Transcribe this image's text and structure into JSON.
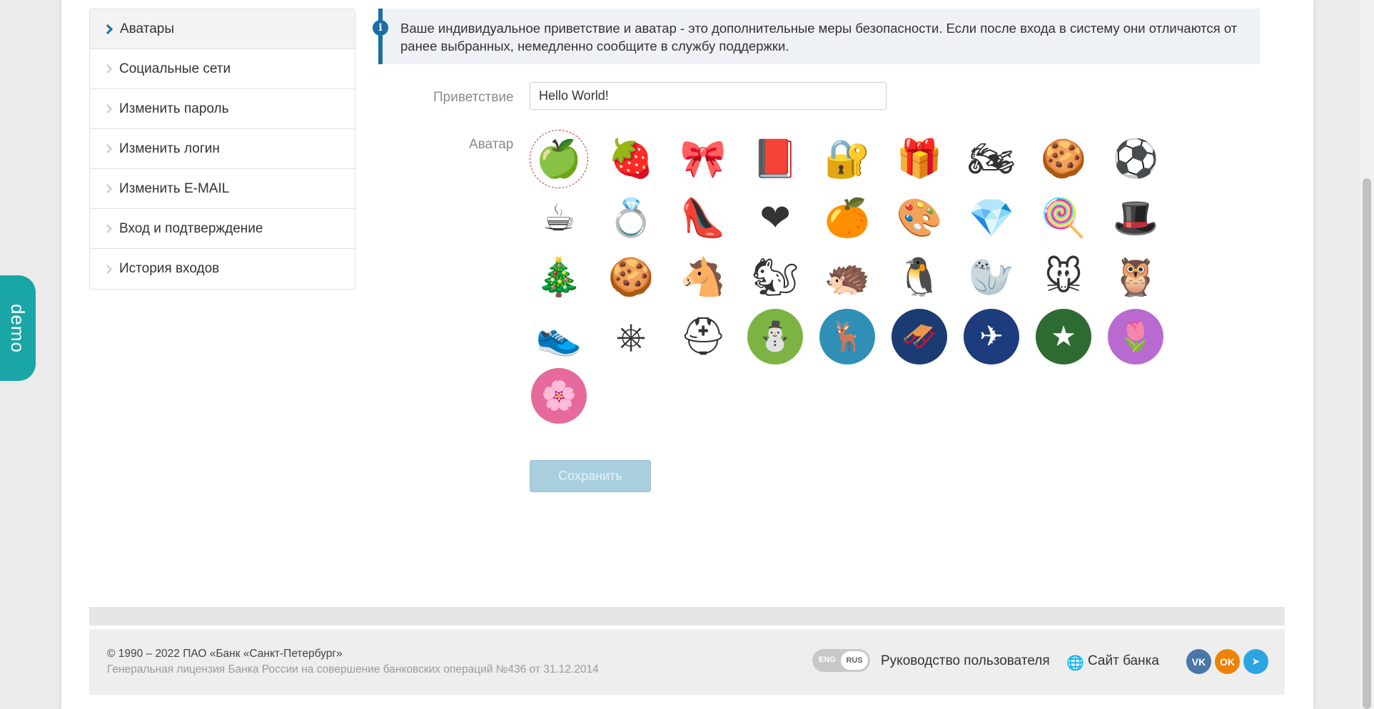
{
  "demo_tab": "demo",
  "sidebar": {
    "items": [
      {
        "label": "Аватары",
        "active": true
      },
      {
        "label": "Социальные сети"
      },
      {
        "label": "Изменить пароль"
      },
      {
        "label": "Изменить логин"
      },
      {
        "label": "Изменить E-MAIL"
      },
      {
        "label": "Вход и подтверждение"
      },
      {
        "label": "История входов"
      }
    ]
  },
  "info": {
    "text": "Ваше индивидуальное приветствие и аватар - это дополнительные меры безопасности. Если после входа в систему они отличаются от ранее выбранных, немедленно сообщите в службу поддержки."
  },
  "form": {
    "greeting_label": "Приветствие",
    "greeting_value": "Hello World!",
    "avatar_label": "Аватар",
    "save_label": "Сохранить"
  },
  "avatars": [
    {
      "name": "green-apple",
      "glyph": "🍏",
      "selected": true
    },
    {
      "name": "raspberry",
      "glyph": "🍓"
    },
    {
      "name": "bow-tie",
      "glyph": "🎀"
    },
    {
      "name": "book",
      "glyph": "📕"
    },
    {
      "name": "safe",
      "glyph": "🔐"
    },
    {
      "name": "gift",
      "glyph": "🎁"
    },
    {
      "name": "motorcycle",
      "glyph": "🏍"
    },
    {
      "name": "cookie",
      "glyph": "🍪"
    },
    {
      "name": "soccer-ball",
      "glyph": "⚽"
    },
    {
      "name": "cup",
      "glyph": "☕"
    },
    {
      "name": "ring",
      "glyph": "💍"
    },
    {
      "name": "high-heels",
      "glyph": "👠"
    },
    {
      "name": "heart-cookie",
      "glyph": "❤"
    },
    {
      "name": "orange",
      "glyph": "🍊"
    },
    {
      "name": "palette",
      "glyph": "🎨"
    },
    {
      "name": "ruby",
      "glyph": "💎"
    },
    {
      "name": "candy-cane",
      "glyph": "🍭"
    },
    {
      "name": "top-hat",
      "glyph": "🎩"
    },
    {
      "name": "gingerbread-tree",
      "glyph": "🎄"
    },
    {
      "name": "gingerbread-man",
      "glyph": "🍪"
    },
    {
      "name": "donkey",
      "glyph": "🐴"
    },
    {
      "name": "squirrel",
      "glyph": "🐿"
    },
    {
      "name": "hedgehog",
      "glyph": "🦔"
    },
    {
      "name": "penguin",
      "glyph": "🐧"
    },
    {
      "name": "walrus",
      "glyph": "🦭"
    },
    {
      "name": "mouse",
      "glyph": "🐭"
    },
    {
      "name": "owl",
      "glyph": "🦉"
    },
    {
      "name": "sneaker",
      "glyph": "👟"
    },
    {
      "name": "steering-wheel",
      "glyph": "⎈"
    },
    {
      "name": "helmet",
      "glyph": "⛑"
    },
    {
      "name": "snowman",
      "glyph": "⛄",
      "bg": "#7cb342"
    },
    {
      "name": "deer",
      "glyph": "🦌",
      "bg": "#2f8fb7"
    },
    {
      "name": "santa-sleigh",
      "glyph": "🛷",
      "bg": "#1b3b73"
    },
    {
      "name": "airplanes",
      "glyph": "✈",
      "bg": "#1c3c7e"
    },
    {
      "name": "red-star",
      "glyph": "★",
      "bg": "#2e6b32"
    },
    {
      "name": "tulips",
      "glyph": "🌷",
      "bg": "#b96ad0"
    },
    {
      "name": "sakura",
      "glyph": "🌸",
      "bg": "#e76a9c"
    }
  ],
  "footer": {
    "copyright": "© 1990 – 2022 ПАО «Банк «Санкт-Петербург»",
    "license": "Генеральная лицензия Банка России на совершение банковских операций №436 от 31.12.2014",
    "lang_eng": "ENG",
    "lang_rus": "RUS",
    "guide_link": "Руководство пользователя",
    "site_link": "Сайт банка",
    "social": [
      {
        "name": "vk",
        "label": "VK",
        "color": "#4a76a8"
      },
      {
        "name": "odnoklassniki",
        "label": "OK",
        "color": "#ee8208"
      },
      {
        "name": "telegram",
        "label": "➤",
        "color": "#2ca5e0"
      }
    ]
  }
}
